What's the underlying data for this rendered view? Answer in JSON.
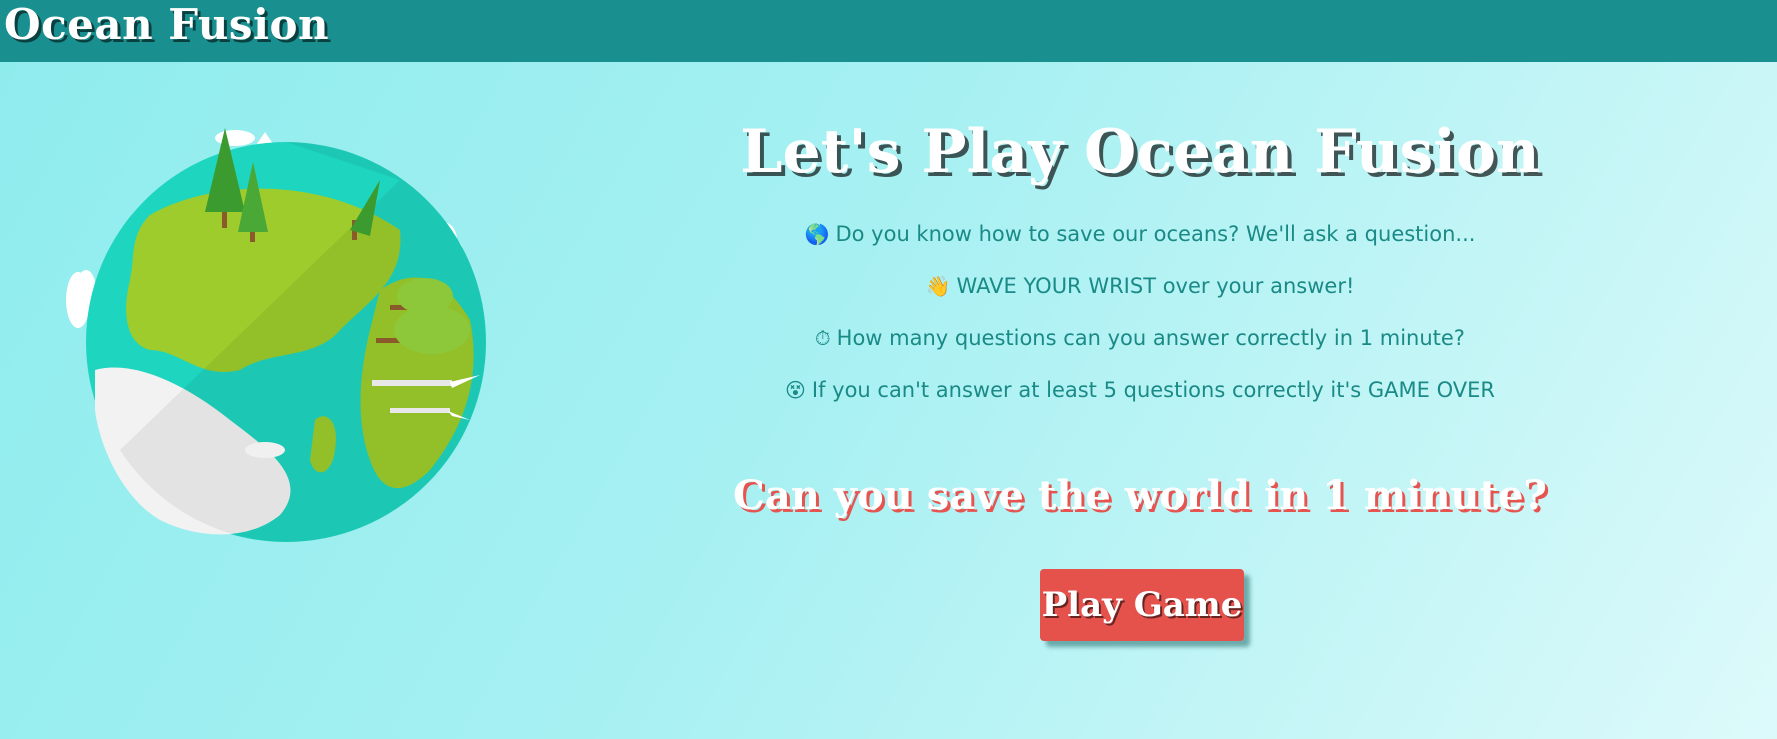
{
  "header": {
    "brand": "Ocean Fusion"
  },
  "main": {
    "title": "Let's Play Ocean Fusion",
    "bullets": [
      {
        "icon": "globe-icon",
        "emoji": "🌎",
        "text": "Do you know how to save our oceans? We'll ask a question..."
      },
      {
        "icon": "waving-hand-icon",
        "emoji": "👋",
        "text": "WAVE YOUR WRIST over your answer!"
      },
      {
        "icon": "stopwatch-icon",
        "emoji": "⏱",
        "text": "How many questions can you answer correctly in 1 minute?"
      },
      {
        "icon": "dizzy-face-icon",
        "emoji": "😵",
        "text": "If you can't answer at least 5 questions correctly it's GAME OVER"
      }
    ],
    "tagline": "Can you save the world in 1 minute?",
    "play_button": "Play Game"
  },
  "colors": {
    "header_bg": "#1a8f8f",
    "accent_text": "#1a8a86",
    "button": "#e5524c",
    "background": "#a6f0f2"
  }
}
